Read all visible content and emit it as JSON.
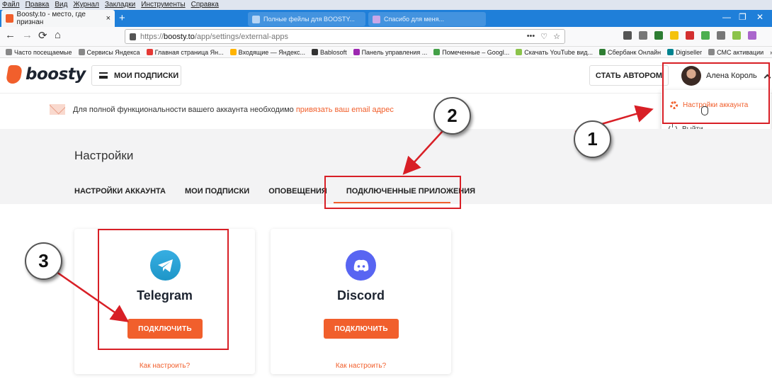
{
  "menubar": [
    "Файл",
    "Правка",
    "Вид",
    "Журнал",
    "Закладки",
    "Инструменты",
    "Справка"
  ],
  "tab": {
    "title": "Boosty.to - место, где признан",
    "close": "×"
  },
  "bg_tabs": [
    "Полные фейлы для BOOSTY...",
    "Спасибо для меня..."
  ],
  "newtab": "+",
  "window_controls": [
    "—",
    "❐",
    "✕"
  ],
  "nav": {
    "back": "←",
    "forward": "→",
    "reload": "⟳",
    "home": "⌂"
  },
  "url": {
    "prefix": "https://",
    "domain": "boosty.to",
    "path": "/app/settings/external-apps",
    "actions": [
      "•••",
      "♡",
      "☆"
    ]
  },
  "toolbar_icon_colors": [
    "#555555",
    "#777777",
    "#2d7d32",
    "#f4c20d",
    "#d32f2f",
    "#4caf50",
    "#777777",
    "#8bc34a",
    "#aa66cc"
  ],
  "bookmarks": [
    {
      "label": "Часто посещаемые",
      "color": "#888888"
    },
    {
      "label": "Сервисы Яндекса",
      "color": "#888888"
    },
    {
      "label": "Главная страница Ян...",
      "color": "#e53935"
    },
    {
      "label": "Входящие — Яндекс...",
      "color": "#ffb300"
    },
    {
      "label": "Bablosoft",
      "color": "#333333"
    },
    {
      "label": "Панель управления ...",
      "color": "#9c27b0"
    },
    {
      "label": "Помеченные – Googl...",
      "color": "#43a047"
    },
    {
      "label": "Скачать YouTube вид...",
      "color": "#8bc34a"
    },
    {
      "label": "Сбербанк Онлайн",
      "color": "#2e7d32"
    },
    {
      "label": "Digiseller",
      "color": "#00838f"
    },
    {
      "label": "СМС активации",
      "color": "#888888"
    }
  ],
  "bookmarks_more": "»",
  "header": {
    "logo": "boosty",
    "subscriptions_button": "МОИ ПОДПИСКИ",
    "author_button": "СТАТЬ АВТОРОМ",
    "user_name": "Алена Король"
  },
  "dropdown": {
    "settings": "Настройки аккаунта",
    "logout": "Выйти"
  },
  "notice": {
    "text": "Для полной функциональности вашего аккаунта необходимо",
    "link": "привязать ваш email адрес"
  },
  "settings": {
    "title": "Настройки",
    "tabs": [
      "НАСТРОЙКИ АККАУНТА",
      "МОИ ПОДПИСКИ",
      "ОПОВЕЩЕНИЯ",
      "ПОДКЛЮЧЕННЫЕ ПРИЛОЖЕНИЯ"
    ],
    "active_tab": "ПОДКЛЮЧЕННЫЕ ПРИЛОЖЕНИЯ"
  },
  "apps": [
    {
      "name": "Telegram",
      "button": "ПОДКЛЮЧИТЬ",
      "link": "Как настроить?"
    },
    {
      "name": "Discord",
      "button": "ПОДКЛЮЧИТЬ",
      "link": "Как настроить?"
    }
  ],
  "annotations": [
    "1",
    "2",
    "3"
  ],
  "colors": {
    "accent": "#f15f2c",
    "highlight": "#d81f26",
    "browser_blue": "#1f7fd9",
    "band": "#f3f3f4"
  }
}
